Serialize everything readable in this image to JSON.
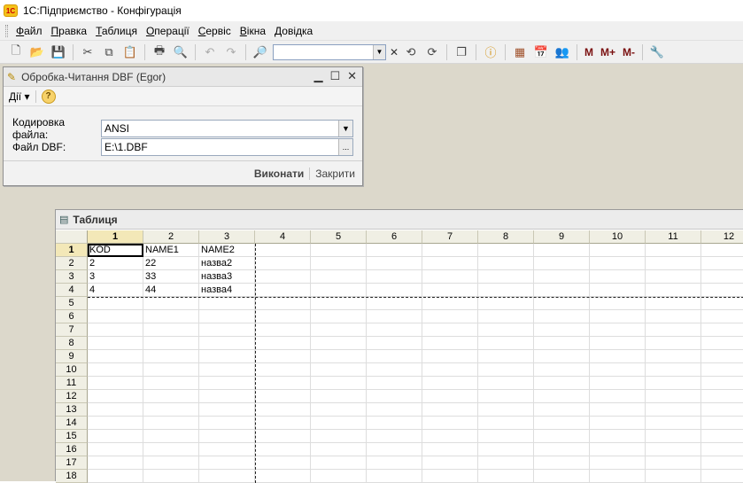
{
  "window": {
    "title": "1С:Підприємство - Конфігурація",
    "logo_text": "1С"
  },
  "menu": [
    "Файл",
    "Правка",
    "Таблиця",
    "Операції",
    "Сервіс",
    "Вікна",
    "Довідка"
  ],
  "toolbar": {
    "icons": [
      "new-icon",
      "open-icon",
      "save-icon",
      "cut-icon",
      "copy-icon",
      "paste-icon",
      "print-icon",
      "preview-icon",
      "undo-icon",
      "redo-icon",
      "search-icon"
    ],
    "search_value": "",
    "m_buttons": [
      "M",
      "M+",
      "M-"
    ]
  },
  "processing": {
    "title": "Обробка-Читання DBF (Egor)",
    "actions_label": "Дії",
    "encoding_label": "Кодировка файла:",
    "encoding_value": "ANSI",
    "file_label": "Файл DBF:",
    "file_value": "E:\\1.DBF",
    "execute_label": "Виконати",
    "close_label": "Закрити",
    "choose_button": "..."
  },
  "table": {
    "title": "Таблиця",
    "columns": [
      "1",
      "2",
      "3",
      "4",
      "5",
      "6",
      "7",
      "8",
      "9",
      "10",
      "11",
      "12"
    ],
    "rows": [
      "1",
      "2",
      "3",
      "4",
      "5",
      "6",
      "7",
      "8",
      "9",
      "10",
      "11",
      "12",
      "13",
      "14",
      "15",
      "16",
      "17",
      "18"
    ],
    "cells": [
      [
        "KOD",
        "NAME1",
        "NAME2"
      ],
      [
        "2",
        "22",
        "назва2"
      ],
      [
        "3",
        "33",
        "назва3"
      ],
      [
        "4",
        "44",
        "назва4"
      ]
    ]
  },
  "colors": {
    "workspace": "#dcd8cb",
    "header_bg": "#f0efe4",
    "accent": "#f4c21a"
  }
}
